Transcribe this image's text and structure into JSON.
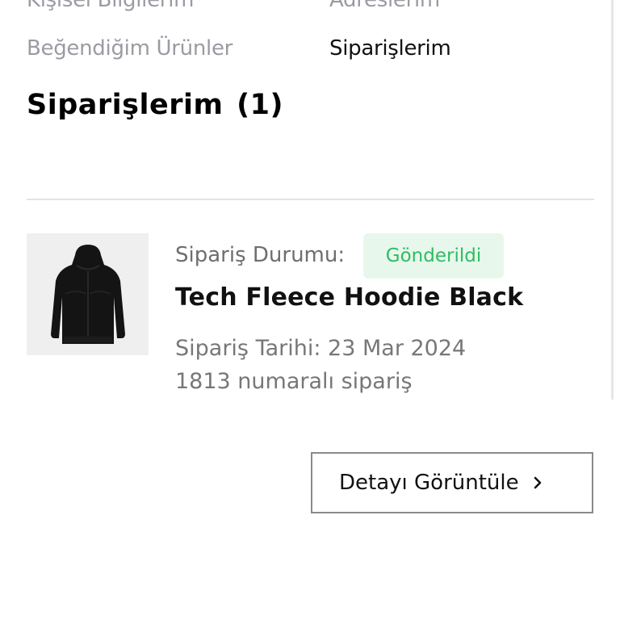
{
  "account_menu": {
    "items": [
      {
        "label": "Kişisel Bilgilerim",
        "active": false
      },
      {
        "label": "Adreslerim",
        "active": false
      },
      {
        "label": "Beğendiğim Ürünler",
        "active": false
      },
      {
        "label": "Siparişlerim",
        "active": true
      }
    ]
  },
  "orders_section": {
    "title": "Siparişlerim",
    "count": "(1)"
  },
  "order": {
    "status_label": "Sipariş Durumu:",
    "status_value": "Gönderildi",
    "product_name": "Tech Fleece Hoodie Black",
    "order_date": "Sipariş Tarihi: 23 Mar 2024",
    "order_number": "1813 numaralı sipariş",
    "detail_button_label": "Detayı Görüntüle",
    "thumbnail_icon": "hoodie-image",
    "status_colors": {
      "text": "#2ebd63",
      "background": "#e8f7ec"
    }
  },
  "colors": {
    "inactive_link": "#9a9ca2",
    "active_link": "#111111"
  }
}
